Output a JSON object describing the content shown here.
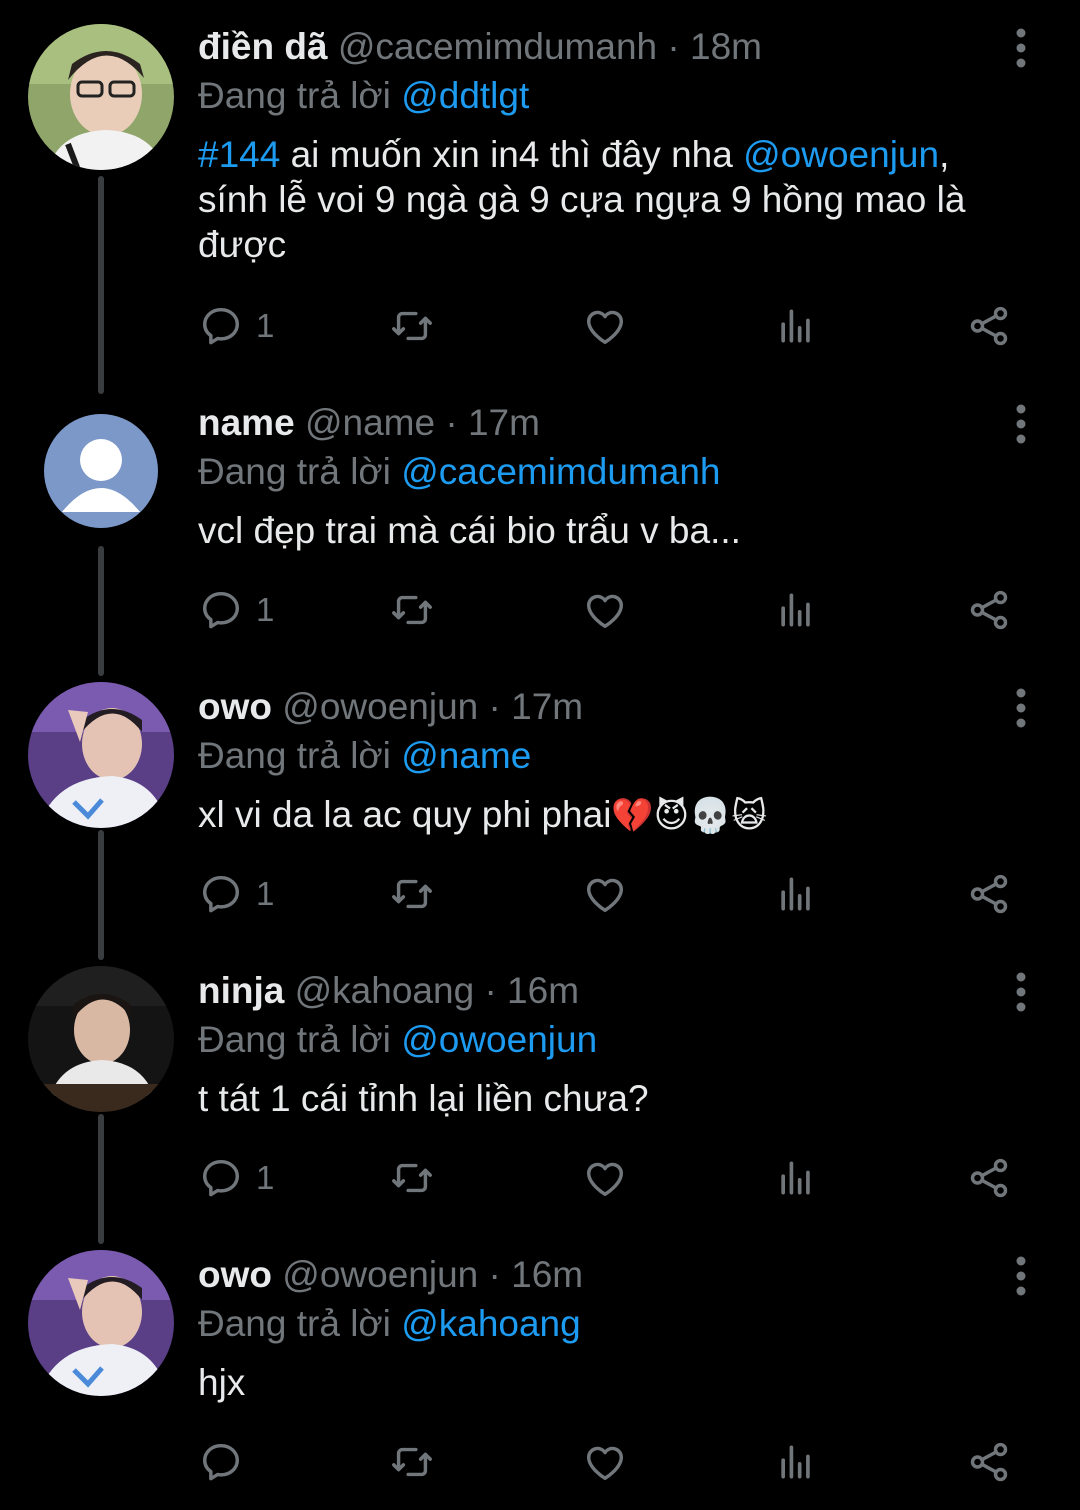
{
  "colors": {
    "background": "#000000",
    "text": "#e7e9ea",
    "muted": "#71767b",
    "link": "#1d9bf0",
    "thread_line": "#3a3d40"
  },
  "tweets": [
    {
      "display_name": "điền dã",
      "handle": "@cacemimdumanh",
      "separator": "·",
      "time": "18m",
      "reply_prefix": "Đang trả lời",
      "reply_to": "@ddtlgt",
      "text": {
        "hashtag": "#144",
        "part1": " ai muốn xin in4 thì đây nha ",
        "mention": "@owoenjun",
        "part2": ", sính lễ voi 9 ngà gà 9 cựa ngựa 9 hồng mao là được"
      },
      "reply_count": "1",
      "avatar": "photo"
    },
    {
      "display_name": "name",
      "handle": "@name",
      "separator": "·",
      "time": "17m",
      "reply_prefix": "Đang trả lời",
      "reply_to": "@cacemimdumanh",
      "text": "vcl đẹp trai mà cái bio trẩu v ba...",
      "reply_count": "1",
      "avatar": "default-person"
    },
    {
      "display_name": "owo",
      "handle": "@owoenjun",
      "separator": "·",
      "time": "17m",
      "reply_prefix": "Đang trả lời",
      "reply_to": "@name",
      "text": "xl vi da la ac quy phi phai",
      "emojis": "💔😈💀🙀",
      "reply_count": "1",
      "avatar": "photo"
    },
    {
      "display_name": "ninja",
      "handle": "@kahoang",
      "separator": "·",
      "time": "16m",
      "reply_prefix": "Đang trả lời",
      "reply_to": "@owoenjun",
      "text": "t tát 1 cái tỉnh lại liền chưa?",
      "reply_count": "1",
      "avatar": "photo"
    },
    {
      "display_name": "owo",
      "handle": "@owoenjun",
      "separator": "·",
      "time": "16m",
      "reply_prefix": "Đang trả lời",
      "reply_to": "@kahoang",
      "text": "hjx",
      "reply_count": "",
      "avatar": "photo"
    }
  ],
  "icons": {
    "reply": "reply-icon",
    "retweet": "retweet-icon",
    "like": "heart-icon",
    "views": "views-icon",
    "share": "share-icon",
    "more": "more-vertical-icon"
  }
}
